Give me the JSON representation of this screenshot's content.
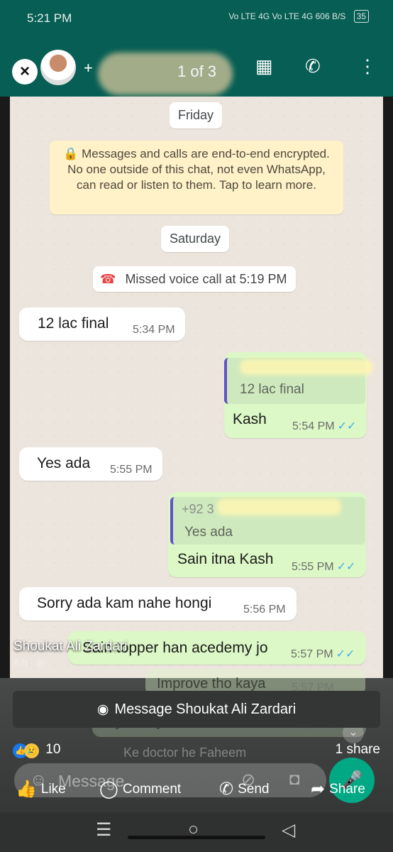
{
  "status_bar": {
    "time": "5:21 PM",
    "indicators": "Vo LTE 4G Vo LTE 4G 606 B/S",
    "battery": "35"
  },
  "header": {
    "close_icon": "close-icon",
    "plus": "+",
    "page_counter": "1 of 3",
    "icons": [
      "shop-icon",
      "call-add-icon",
      "more-icon"
    ]
  },
  "chat": {
    "day_friday": "Friday",
    "encryption_notice": "🔒 Messages and calls are end-to-end encrypted. No one outside of this chat, not even WhatsApp, can read or listen to them. Tap to learn more.",
    "day_saturday": "Saturday",
    "missed_call": "Missed voice call at 5:19 PM",
    "messages": [
      {
        "dir": "in",
        "text": "12 lac final",
        "time": "5:34 PM"
      },
      {
        "dir": "out",
        "quote_text": "12 lac final",
        "text": "Kash",
        "time": "5:54 PM"
      },
      {
        "dir": "in",
        "text": "Yes ada",
        "time": "5:55 PM"
      },
      {
        "dir": "out",
        "quote_sender": "+92 3",
        "quote_text": "Yes ada",
        "text": "Sain itna Kash",
        "time": "5:55 PM"
      },
      {
        "dir": "in",
        "text": "Sorry ada kam nahe hongi",
        "time": "5:56 PM"
      },
      {
        "dir": "out",
        "text": "Sain topper han acedemy jo",
        "time": "5:57 PM"
      },
      {
        "dir": "out",
        "text": "Improve tho kaya",
        "time": "5:57 PM"
      },
      {
        "dir": "out",
        "text": "My family dream ha sain",
        "time": "5:57 PM"
      },
      {
        "dir": "out",
        "text": "Ke doctor he Faheem",
        "time": ""
      }
    ]
  },
  "post_overlay": {
    "author": "Shoukat Ali Zardari",
    "time_ago": "8 h",
    "message_button": "Message Shoukat Ali Zardari",
    "reaction_count": "10",
    "share_count": "1 share",
    "ghost_composer": "Message",
    "actions": {
      "like": "Like",
      "comment": "Comment",
      "send": "Send",
      "share": "Share"
    }
  }
}
